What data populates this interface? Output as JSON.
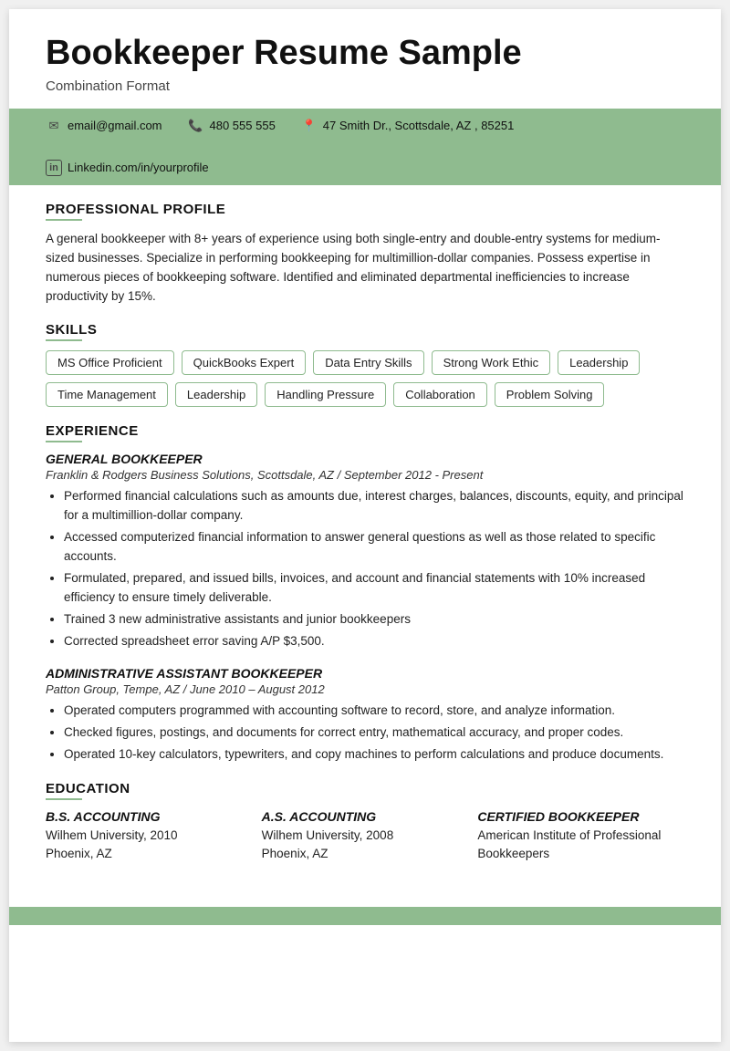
{
  "header": {
    "title": "Bookkeeper Resume Sample",
    "format": "Combination Format"
  },
  "contact": {
    "email": "email@gmail.com",
    "phone": "480 555 555",
    "address": "47 Smith Dr., Scottsdale, AZ , 85251",
    "linkedin": "Linkedin.com/in/yourprofile"
  },
  "sections": {
    "profile": {
      "heading": "PROFESSIONAL PROFILE",
      "text": "A general bookkeeper with 8+ years of experience using both single-entry and double-entry systems for medium-sized businesses. Specialize in performing bookkeeping for multimillion-dollar companies. Possess expertise in numerous pieces of bookkeeping software. Identified and eliminated departmental inefficiencies to increase productivity by 15%."
    },
    "skills": {
      "heading": "SKILLS",
      "items": [
        "MS Office Proficient",
        "QuickBooks Expert",
        "Data Entry Skills",
        "Strong Work Ethic",
        "Leadership",
        "Time Management",
        "Leadership",
        "Handling Pressure",
        "Collaboration",
        "Problem Solving"
      ]
    },
    "experience": {
      "heading": "EXPERIENCE",
      "jobs": [
        {
          "title": "GENERAL BOOKKEEPER",
          "company": "Franklin & Rodgers Business Solutions, Scottsdale, AZ",
          "dates": "September 2012 - Present",
          "bullets": [
            "Performed financial calculations such as amounts due, interest charges, balances, discounts, equity, and principal for a multimillion-dollar company.",
            "Accessed computerized financial information to answer general questions as well as those related to specific accounts.",
            "Formulated, prepared, and issued bills, invoices, and account and financial statements with 10% increased efficiency to ensure timely deliverable.",
            "Trained 3 new administrative assistants and junior bookkeepers",
            "Corrected spreadsheet error saving A/P $3,500."
          ]
        },
        {
          "title": "ADMINISTRATIVE ASSISTANT BOOKKEEPER",
          "company": "Patton Group, Tempe, AZ",
          "dates": "June 2010 – August 2012",
          "bullets": [
            "Operated computers programmed with accounting software to record, store, and analyze information.",
            "Checked figures, postings, and documents for correct entry, mathematical accuracy, and proper codes.",
            "Operated 10-key calculators, typewriters, and copy machines to perform calculations and produce documents."
          ]
        }
      ]
    },
    "education": {
      "heading": "EDUCATION",
      "entries": [
        {
          "degree": "B.S. ACCOUNTING",
          "detail1": "Wilhem University, 2010",
          "detail2": "Phoenix, AZ"
        },
        {
          "degree": "A.S. ACCOUNTING",
          "detail1": "Wilhem University, 2008",
          "detail2": "Phoenix, AZ"
        },
        {
          "degree": "CERTIFIED BOOKKEEPER",
          "detail1": "American Institute of Professional Bookkeepers",
          "detail2": ""
        }
      ]
    }
  }
}
